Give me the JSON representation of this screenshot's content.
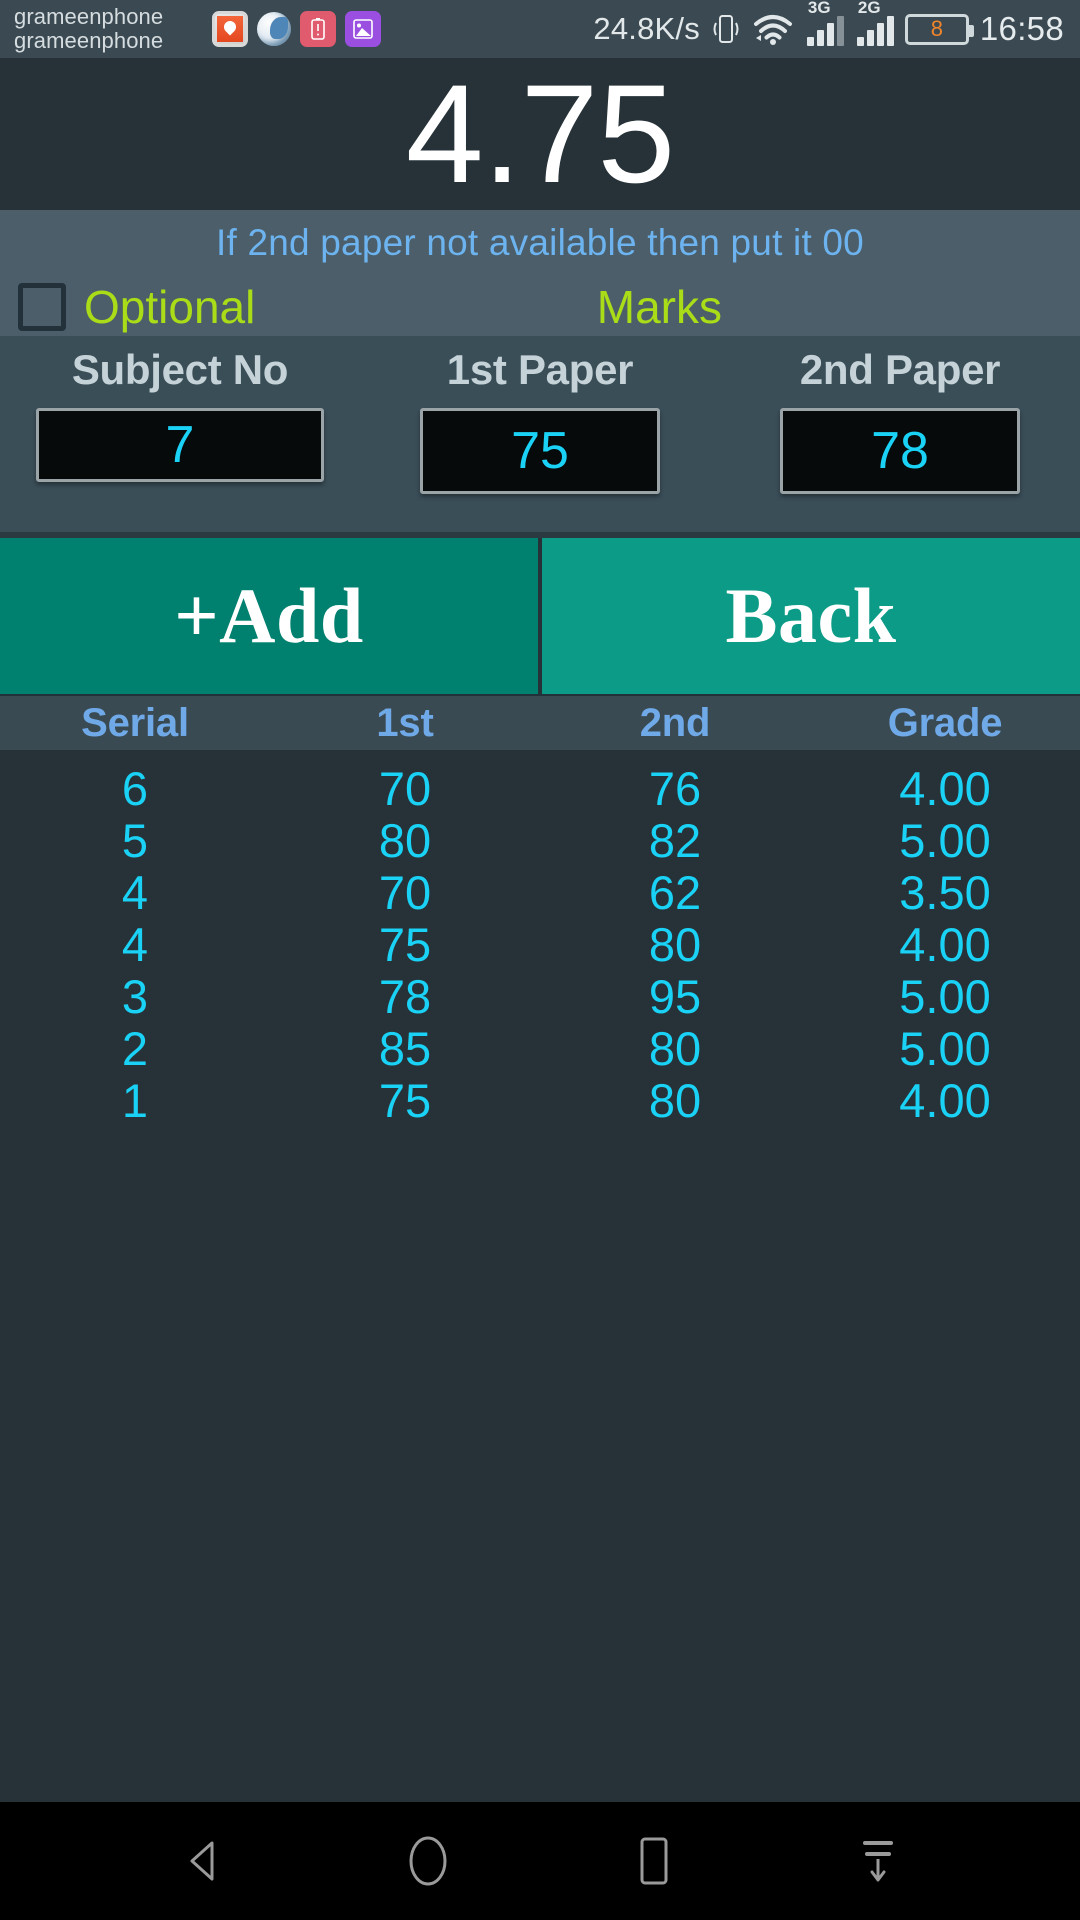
{
  "statusbar": {
    "carrier_line1": "grameenphone",
    "carrier_line2": "grameenphone",
    "app_icons": [
      "mail-icon",
      "browser-icon",
      "battery-alert-icon",
      "gallery-icon"
    ],
    "net_speed": "24.8K/s",
    "vibrate_icon": "vibrate-icon",
    "wifi_icon": "wifi-icon",
    "sim1_network": "3G",
    "sim2_network": "2G",
    "battery_level": "8",
    "battery_color": "#f0842a",
    "clock": "16:58"
  },
  "header": {
    "score": "4.75"
  },
  "hint": {
    "text": "If 2nd paper not available then put it 00",
    "color": "#6cb3ef"
  },
  "options": {
    "checkbox_label": "Optional",
    "checkbox_checked": false,
    "marks_label": "Marks",
    "label_color": "#aadc18"
  },
  "form": {
    "columns": [
      "Subject No",
      "1st Paper",
      "2nd Paper"
    ],
    "values": [
      "7",
      "75",
      "78"
    ],
    "value_color": "#1ad2f5"
  },
  "buttons": {
    "add_label": "+Add",
    "back_label": "Back",
    "add_color": "#00806f",
    "back_color": "#0c9b86"
  },
  "table": {
    "headers": [
      "Serial",
      "1st",
      "2nd",
      "Grade"
    ],
    "header_color": "#6fa9e8",
    "row_color": "#1ad2f5",
    "rows": [
      {
        "serial": "6",
        "first": "70",
        "second": "76",
        "grade": "4.00"
      },
      {
        "serial": "5",
        "first": "80",
        "second": "82",
        "grade": "5.00"
      },
      {
        "serial": "4",
        "first": "70",
        "second": "62",
        "grade": "3.50"
      },
      {
        "serial": "4",
        "first": "75",
        "second": "80",
        "grade": "4.00"
      },
      {
        "serial": "3",
        "first": "78",
        "second": "95",
        "grade": "5.00"
      },
      {
        "serial": "2",
        "first": "85",
        "second": "80",
        "grade": "5.00"
      },
      {
        "serial": "1",
        "first": "75",
        "second": "80",
        "grade": "4.00"
      }
    ]
  },
  "navbar": {
    "items": [
      "back-icon",
      "home-icon",
      "recents-icon",
      "pulldown-icon"
    ]
  }
}
